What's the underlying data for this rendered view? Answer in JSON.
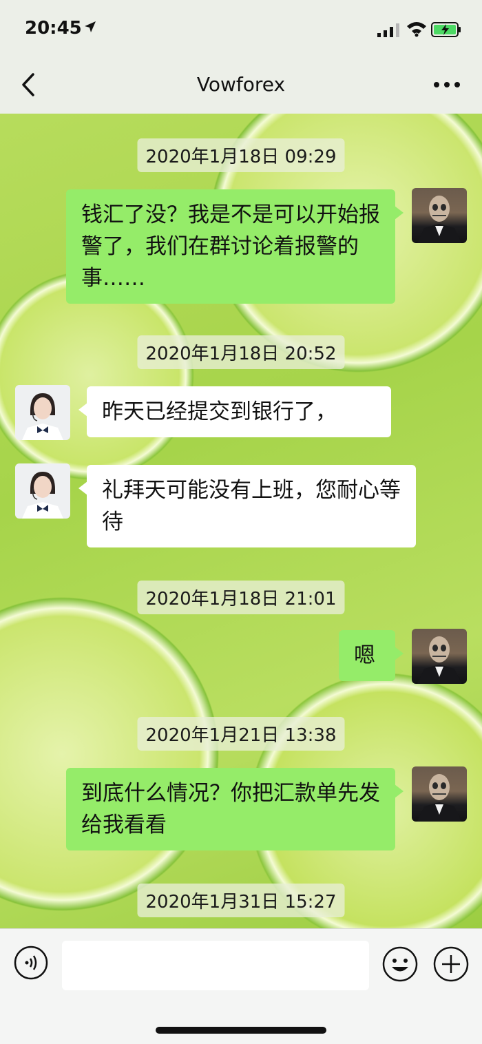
{
  "status_bar": {
    "time": "20:45"
  },
  "nav": {
    "title": "Vowforex"
  },
  "messages": [
    {
      "type": "timestamp",
      "text": "2020年1月18日 09:29"
    },
    {
      "type": "sent",
      "text": "钱汇了没？我是不是可以开始报警了，我们在群讨论着报警的事……"
    },
    {
      "type": "timestamp",
      "text": "2020年1月18日 20:52"
    },
    {
      "type": "received",
      "text": "昨天已经提交到银行了，"
    },
    {
      "type": "received",
      "text": "礼拜天可能没有上班，您耐心等待"
    },
    {
      "type": "timestamp",
      "text": "2020年1月18日 21:01"
    },
    {
      "type": "sent",
      "text": "嗯"
    },
    {
      "type": "timestamp",
      "text": "2020年1月21日 13:38"
    },
    {
      "type": "sent",
      "text": "到底什么情况？你把汇款单先发给我看看"
    },
    {
      "type": "timestamp",
      "text": "2020年1月31日 15:27"
    }
  ],
  "input": {
    "value": "",
    "placeholder": ""
  },
  "colors": {
    "sent_bubble": "#95ec69",
    "received_bubble": "#ffffff",
    "nav_bg": "#ecefe8",
    "background_accent": "#a6d44a"
  },
  "icons": [
    "location-arrow-icon",
    "signal-icon",
    "wifi-icon",
    "battery-charging-icon",
    "back-chevron-icon",
    "more-dots-icon",
    "voice-icon",
    "emoji-icon",
    "plus-icon"
  ]
}
